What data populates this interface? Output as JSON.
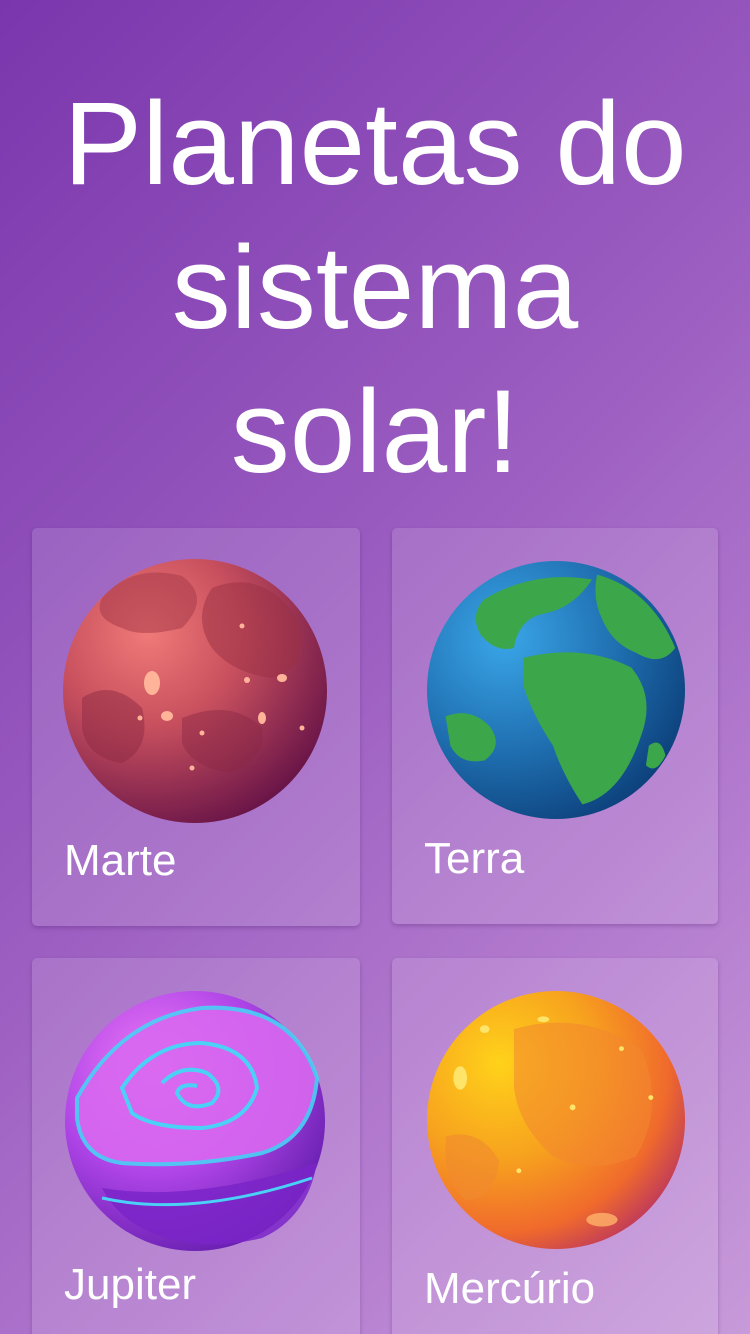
{
  "page": {
    "title_lines": [
      "Planetas do",
      "sistema",
      "solar!"
    ]
  },
  "planets": [
    {
      "name": "Marte",
      "icon": "mars-planet-icon",
      "color": "#c8505e"
    },
    {
      "name": "Terra",
      "icon": "earth-planet-icon",
      "color": "#2b86c9"
    },
    {
      "name": "Jupiter",
      "icon": "jupiter-planet-icon",
      "color": "#a040e0"
    },
    {
      "name": "Mercúrio",
      "icon": "mercury-planet-icon",
      "color": "#f48a2a"
    }
  ]
}
